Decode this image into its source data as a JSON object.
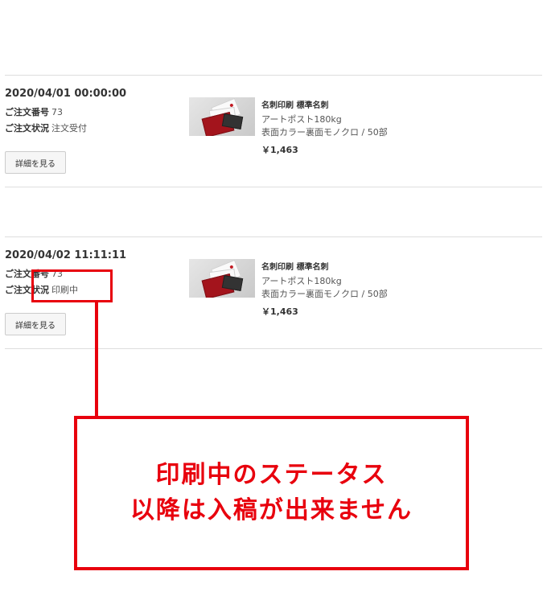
{
  "orders": [
    {
      "datetime": "2020/04/01 00:00:00",
      "order_number_label": "ご注文番号",
      "order_number": "73",
      "status_label": "ご注文状況",
      "status": "注文受付",
      "detail_button": "詳細を見る",
      "product": {
        "name": "名刺印刷 標準名刺",
        "paper": "アートポスト180kg",
        "spec": "表面カラー裏面モノクロ / 50部",
        "price": "￥1,463"
      }
    },
    {
      "datetime": "2020/04/02 11:11:11",
      "order_number_label": "ご注文番号",
      "order_number": "73",
      "status_label": "ご注文状況",
      "status": "印刷中",
      "detail_button": "詳細を見る",
      "product": {
        "name": "名刺印刷 標準名刺",
        "paper": "アートポスト180kg",
        "spec": "表面カラー裏面モノクロ / 50部",
        "price": "￥1,463"
      }
    }
  ],
  "annotation": {
    "line1": "印刷中のステータス",
    "line2": "以降は入稿が出来ません",
    "color": "#e8000d"
  },
  "icons": {
    "product_thumbnail": "business-card-photo-icon"
  }
}
